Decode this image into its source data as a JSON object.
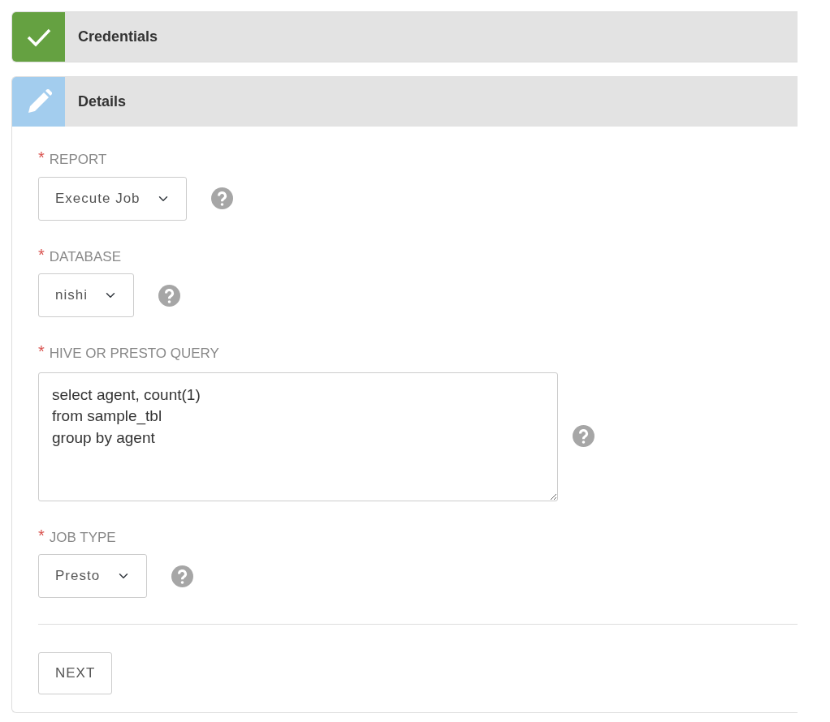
{
  "steps": [
    {
      "title": "Credentials",
      "kind": "done"
    },
    {
      "title": "Details",
      "kind": "editing",
      "fields": [
        {
          "kind": "select",
          "label": "REPORT",
          "required_mark": "*",
          "value": "Execute Job"
        },
        {
          "kind": "select",
          "label": "DATABASE",
          "required_mark": "*",
          "value": "nishi"
        },
        {
          "kind": "textarea",
          "label": "HIVE OR PRESTO QUERY",
          "required_mark": "*",
          "value": "select agent, count(1)\nfrom sample_tbl\ngroup by agent"
        },
        {
          "kind": "select",
          "label": "JOB TYPE",
          "required_mark": "*",
          "value": "Presto"
        }
      ],
      "button": "NEXT"
    }
  ]
}
